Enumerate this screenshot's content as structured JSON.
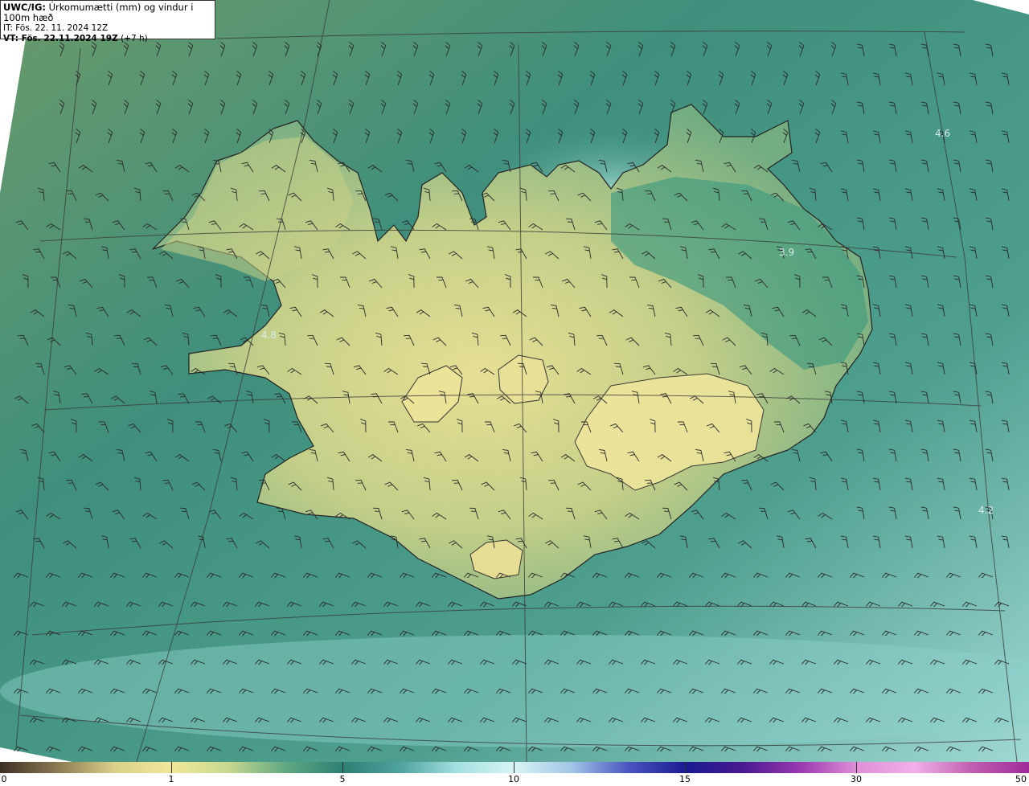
{
  "header": {
    "product": "UWC/IG:",
    "description": "Úrkomumætti (mm) og vindur i 100m hæð",
    "init_time": "IT: Fös. 22. 11. 2024 12Z",
    "valid_prefix": "VT: Fös. 22.11.2024 19Z",
    "valid_offset": "(+7 h)"
  },
  "map_labels": [
    "4.6",
    "3.9",
    "4.8",
    "4.2"
  ],
  "colorbar": {
    "labels": [
      "0",
      "1",
      "5",
      "10",
      "15",
      "30",
      "50"
    ],
    "colors": [
      "#3d2f24",
      "#8a7a52",
      "#d9d08a",
      "#f0e89a",
      "#c8d890",
      "#5fa882",
      "#2e7f73",
      "#4fa3a0",
      "#a4e0e0",
      "#d8f4f4",
      "#a0c4e6",
      "#4a54c0",
      "#1a1a90",
      "#4a1890",
      "#9a3ab0",
      "#e090d8",
      "#f0b0e8",
      "#c060b0",
      "#a02a9a"
    ]
  },
  "colors": {
    "land_low": "#d6d58c",
    "land_mid": "#8fba7f",
    "sea": "#3f8f7c",
    "sea_light": "#7fc4bd",
    "coast": "#222222"
  }
}
